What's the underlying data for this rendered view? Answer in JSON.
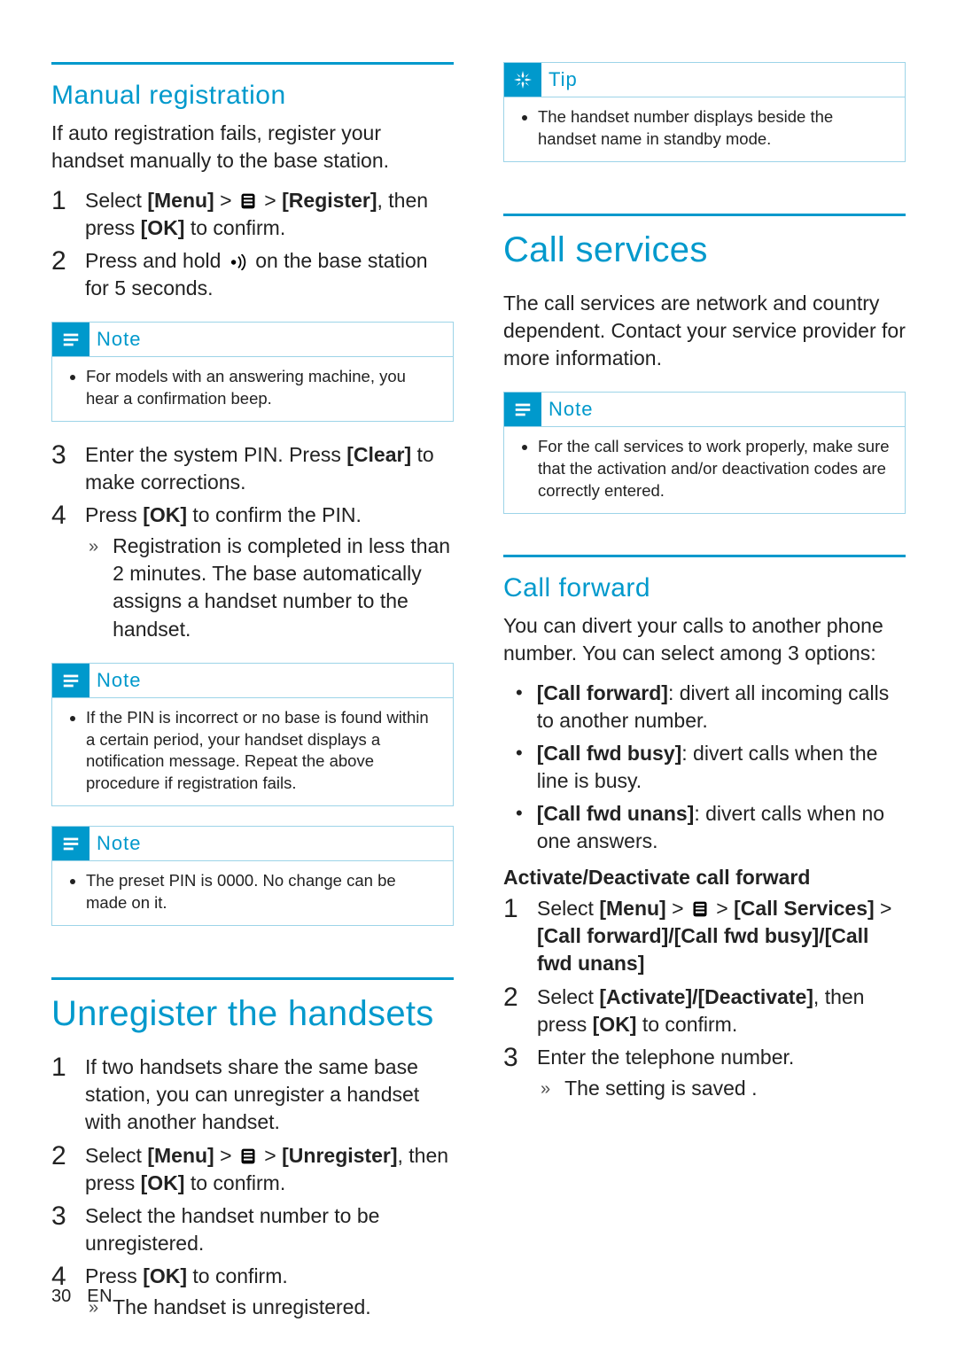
{
  "footer": {
    "page_number": "30",
    "lang": "EN"
  },
  "icons": {
    "settings": "settings-icon",
    "antenna": "antenna-icon"
  },
  "left": {
    "manual_registration": {
      "heading": "Manual registration",
      "intro": "If auto registration fails, register your handset manually to the base station.",
      "step1_a": "Select ",
      "step1_menu": "[Menu]",
      "step1_gt1": " > ",
      "step1_gt2": " > ",
      "step1_register": "[Register]",
      "step1_b": ", then press ",
      "step1_ok": "[OK]",
      "step1_c": " to confirm.",
      "step2_a": "Press and hold ",
      "step2_b": " on the base station for 5 seconds.",
      "note1": "For models with an answering machine, you hear a confirmation beep.",
      "step3_a": "Enter the system PIN. Press ",
      "step3_clear": "[Clear]",
      "step3_b": " to make corrections.",
      "step4_a": "Press ",
      "step4_ok": "[OK]",
      "step4_b": " to confirm the PIN.",
      "step4_sub": "Registration is completed in less than 2 minutes. The base automatically assigns a handset number to the handset.",
      "note2": "If the PIN is incorrect or no base is found within a certain period, your handset displays a notification message. Repeat the above procedure if registration fails.",
      "note3": "The preset PIN is 0000. No change can be made on it."
    },
    "unregister": {
      "heading": "Unregister the handsets",
      "step1": "If two handsets share the same base station, you can unregister a handset with another handset.",
      "step2_a": "Select ",
      "step2_menu": "[Menu]",
      "step2_gt1": " > ",
      "step2_gt2": " > ",
      "step2_unreg": "[Unregister]",
      "step2_b": ", then press ",
      "step2_ok": "[OK]",
      "step2_c": " to confirm.",
      "step3": "Select the handset number to be unregistered.",
      "step4_a": "Press ",
      "step4_ok": "[OK]",
      "step4_b": " to confirm.",
      "step4_sub": "The handset is unregistered."
    }
  },
  "right": {
    "tip": "The handset number displays beside the handset name in standby mode.",
    "call_services": {
      "heading": "Call services",
      "intro": "The call services are network and country dependent. Contact your service provider for more information.",
      "note": "For the call services to work properly, make sure that the activation and/or deactivation codes are correctly entered."
    },
    "call_forward": {
      "heading": "Call forward",
      "intro": "You can divert your calls to another phone number. You can select among 3 options:",
      "opt1_label": "[Call forward]",
      "opt1_desc": ": divert all incoming calls to another number.",
      "opt2_label": "[Call fwd busy]",
      "opt2_desc": ": divert calls when the line is busy.",
      "opt3_label": "[Call fwd unans]",
      "opt3_desc": ": divert calls when no one answers.",
      "activate_heading": "Activate/Deactivate call forward",
      "step1_a": "Select ",
      "step1_menu": "[Menu]",
      "step1_gt1": " > ",
      "step1_gt2": " > ",
      "step1_cs": "[Call Services]",
      "step1_gt3": " > ",
      "step1_opts": "[Call forward]/[Call fwd busy]/[Call fwd unans]",
      "step2_a": "Select ",
      "step2_act": "[Activate]/[Deactivate]",
      "step2_b": ", then press ",
      "step2_ok": "[OK]",
      "step2_c": " to confirm.",
      "step3": "Enter the telephone number.",
      "step3_sub": "The setting is saved ."
    }
  },
  "labels": {
    "note": "Note",
    "tip": "Tip"
  }
}
